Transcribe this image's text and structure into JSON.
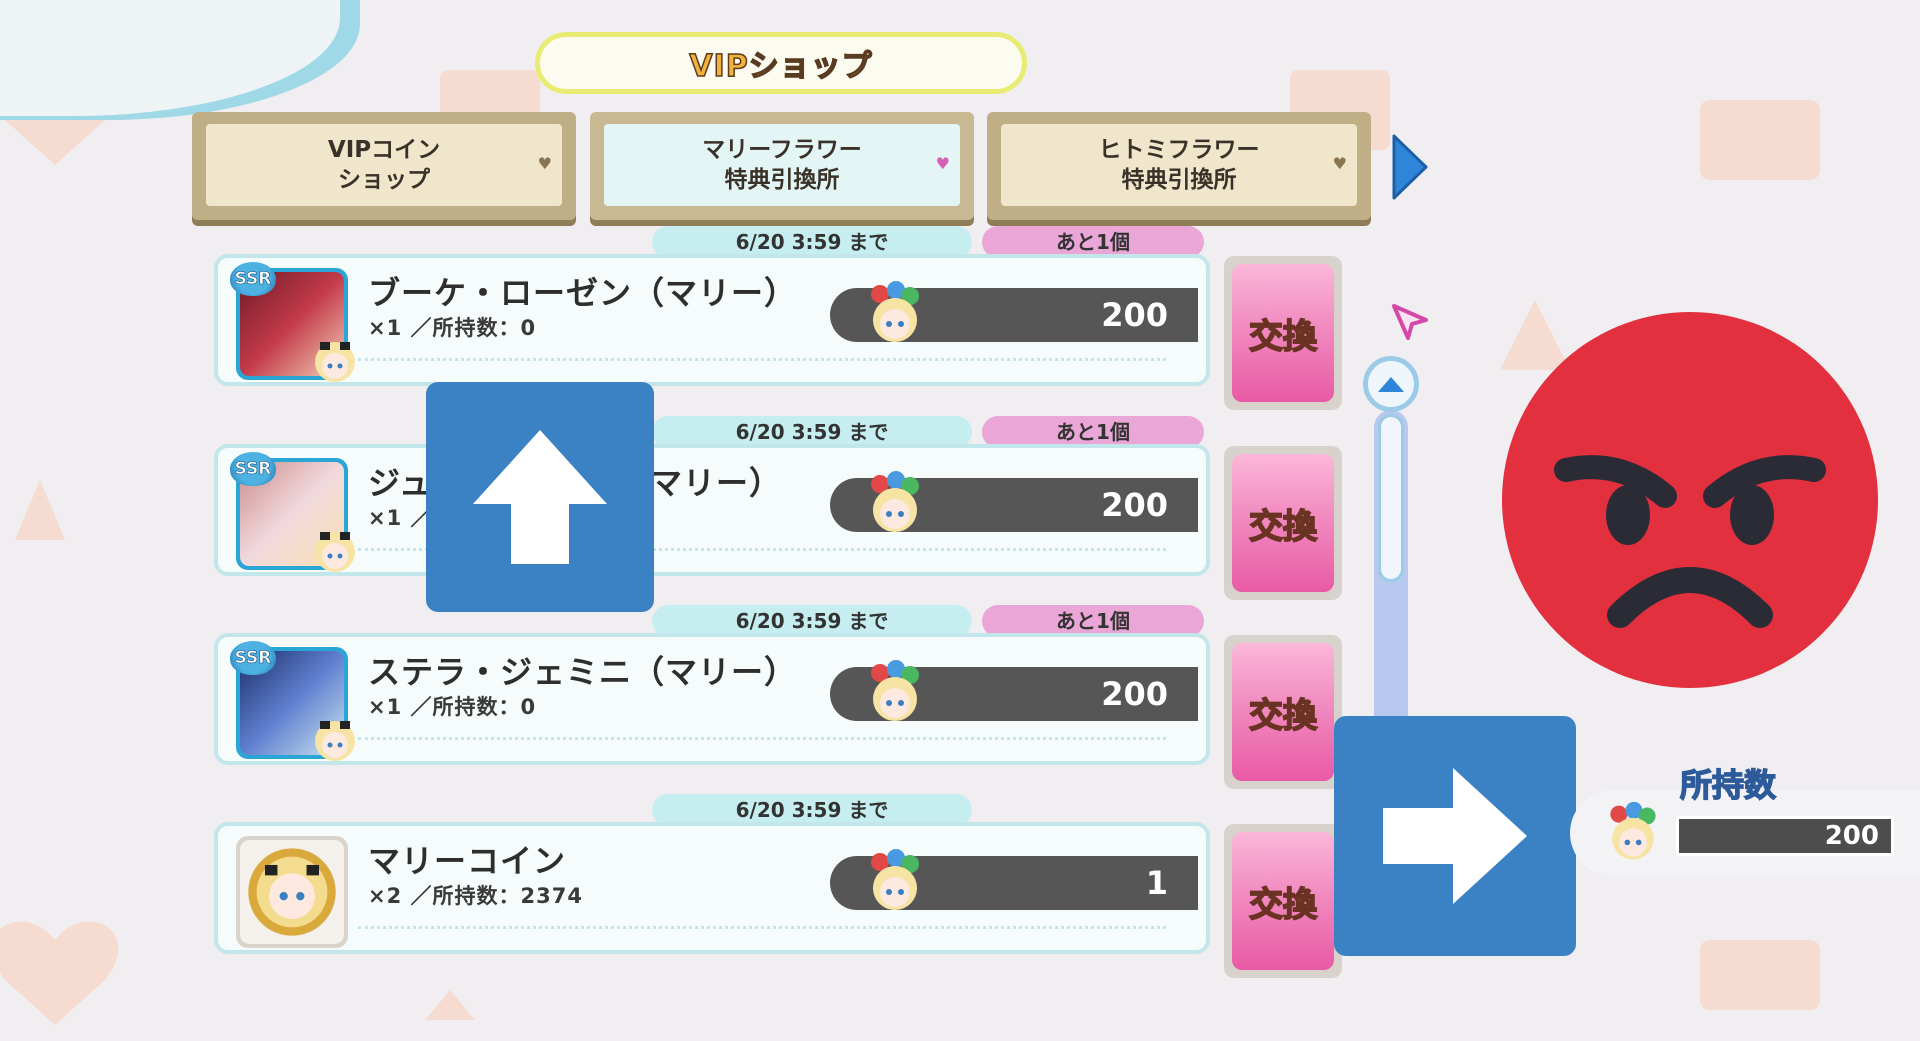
{
  "shop_title": "VIPショップ",
  "tabs": [
    {
      "line1": "VIPコイン",
      "line2": "ショップ",
      "active": false
    },
    {
      "line1": "マリーフラワー",
      "line2": "特典引換所",
      "active": true
    },
    {
      "line1": "ヒトミフラワー",
      "line2": "特典引換所",
      "active": false
    }
  ],
  "items": [
    {
      "deadline": "6/20 3:59 まで",
      "remaining": "あと1個",
      "rarity": "SSR",
      "name": "ブーケ・ローゼン（マリー）",
      "meta": "×1 ／所持数：0",
      "cost": "200",
      "exchange_label": "交換",
      "thumb_color": "#b3263a"
    },
    {
      "deadline": "6/20 3:59 まで",
      "remaining": "あと1個",
      "rarity": "SSR",
      "name": "ジュ",
      "name_tail": "マリー）",
      "meta": "×1 ／",
      "cost": "200",
      "exchange_label": "交換",
      "thumb_color": "#e7c7cf"
    },
    {
      "deadline": "6/20 3:59 まで",
      "remaining": "あと1個",
      "rarity": "SSR",
      "name": "ステラ・ジェミニ（マリー）",
      "meta": "×1 ／所持数：0",
      "cost": "200",
      "exchange_label": "交換",
      "thumb_color": "#2a4d8f"
    },
    {
      "deadline": "6/20 3:59 まで",
      "remaining": "",
      "rarity": "",
      "name": "マリーコイン",
      "meta": "×2 ／所持数：2374",
      "cost": "1",
      "exchange_label": "交換",
      "thumb_color": "#e4c66a"
    }
  ],
  "owned": {
    "label": "所持数",
    "value": "200"
  },
  "icons": {
    "tab_next": "triangle-right-icon",
    "scroll_up": "chevron-up-icon",
    "cursor": "pointer-cursor-icon",
    "up_arrow": "arrow-up-icon",
    "right_arrow": "arrow-right-icon",
    "angry": "angry-face-icon",
    "flower_currency": "marie-flower-icon"
  },
  "colors": {
    "accent_pink": "#ee6fb3",
    "accent_blue": "#3b82c4",
    "angry_red": "#e2303f"
  }
}
